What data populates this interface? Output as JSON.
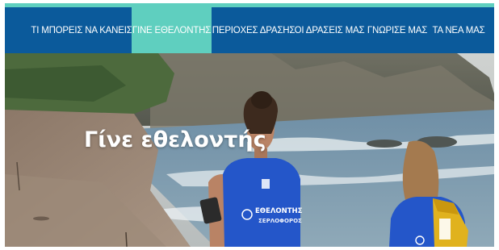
{
  "nav": {
    "items": [
      {
        "label": "ΤΙ ΜΠΟΡΕΙΣ ΝΑ ΚΑΝΕΙΣ",
        "active": false
      },
      {
        "label": "ΓΙΝΕ ΕΘΕΛΟΝΤΗΣ",
        "active": true
      },
      {
        "label": "ΠΕΡΙΟΧΕΣ ΔΡΑΣΗΣ",
        "active": false
      },
      {
        "label": "ΟΙ ΔΡΑΣΕΙΣ ΜΑΣ",
        "active": false
      },
      {
        "label": "ΓΝΩΡΙΣΕ ΜΑΣ",
        "active": false
      },
      {
        "label": "ΤΑ ΝΕΑ ΜΑΣ",
        "active": false
      }
    ]
  },
  "hero": {
    "title": "Γίνε εθελοντής",
    "shirt_text": "ΕΘΕΛΟΝΤΗΣ"
  },
  "colors": {
    "nav_background": "#0b5a9b",
    "active_tab": "#5fcfbf",
    "shirt_blue": "#2456c9"
  }
}
